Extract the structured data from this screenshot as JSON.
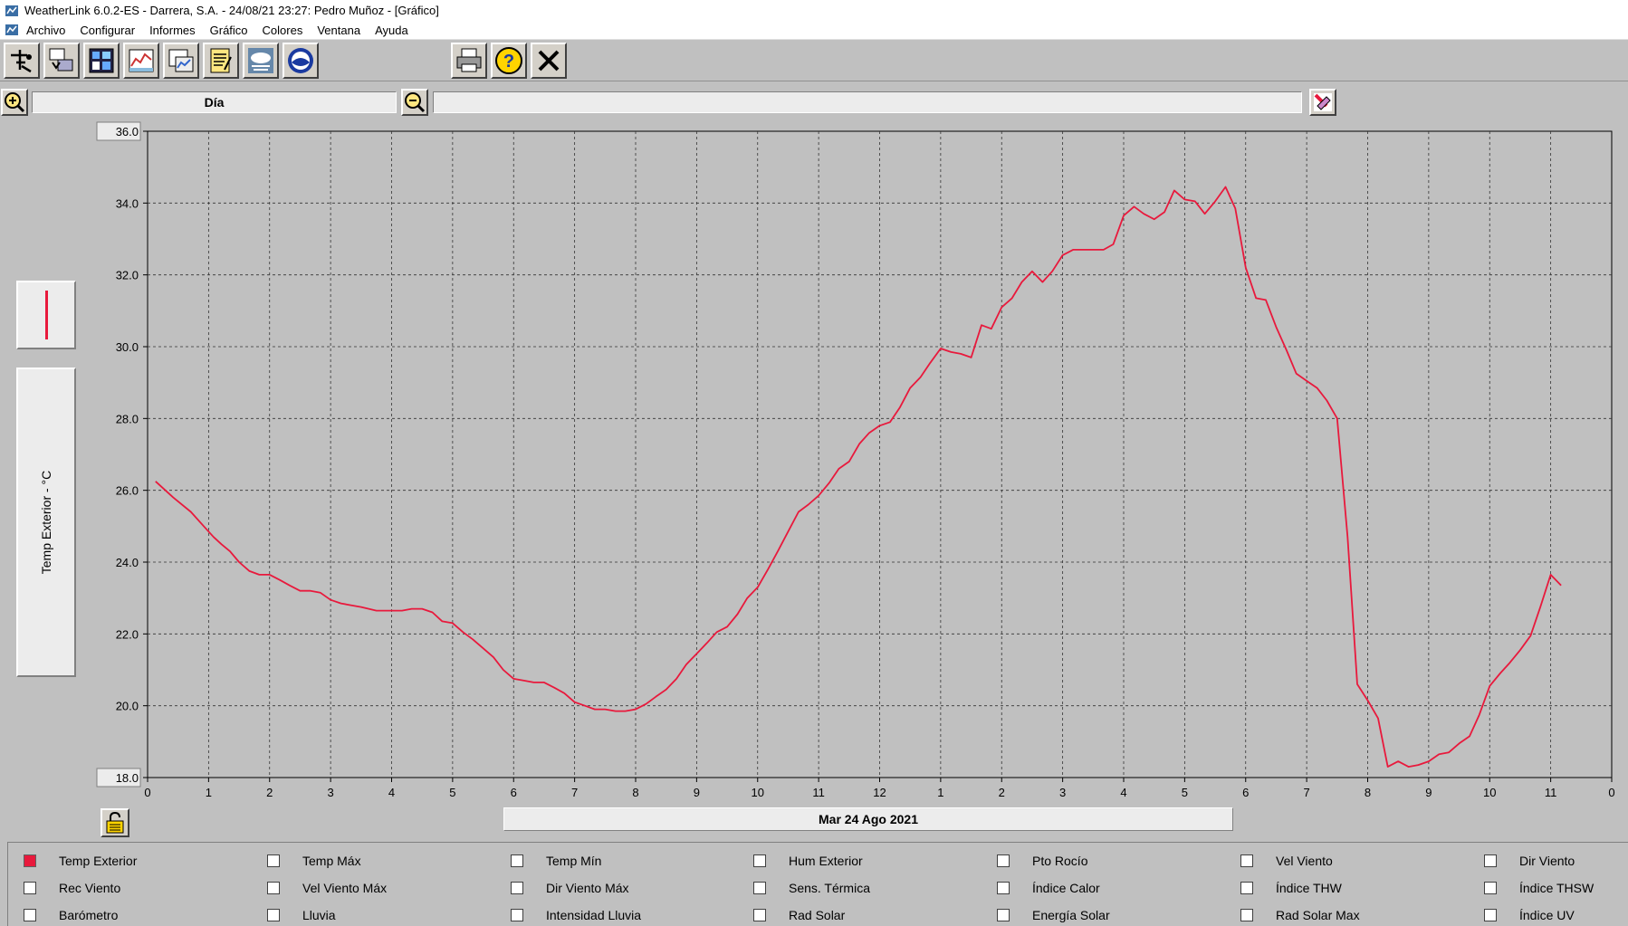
{
  "window": {
    "title": "WeatherLink 6.0.2-ES  -  Darrera, S.A.  -  24/08/21  23:27: Pedro Muñoz - [Gráfico]"
  },
  "menu": [
    "Archivo",
    "Configurar",
    "Informes",
    "Gráfico",
    "Colores",
    "Ventana",
    "Ayuda"
  ],
  "toolbar": {
    "buttons": [
      "teleport-icon",
      "download-icon",
      "bulletin-icon",
      "plot-icon",
      "browse-icon",
      "notes-icon",
      "weather-icon",
      "noaa-icon",
      "print-icon",
      "help-icon",
      "close-icon"
    ]
  },
  "zoom": {
    "period_label": "Día",
    "secondary_label": ""
  },
  "chart_side": {
    "axis_label": "Temp Exterior - °C",
    "series_color": "#e8193c"
  },
  "date_label": "Mar 24 Ago 2021",
  "chart_data": {
    "type": "line",
    "ylabel": "Temp Exterior - °C",
    "ylim": [
      18.0,
      36.0
    ],
    "yticks": [
      "36.0",
      "34.0",
      "32.0",
      "30.0",
      "28.0",
      "26.0",
      "24.0",
      "22.0",
      "20.0",
      "18.0"
    ],
    "xlim": [
      0,
      24
    ],
    "xticks": [
      "0",
      "1",
      "2",
      "3",
      "4",
      "5",
      "6",
      "7",
      "8",
      "9",
      "10",
      "11",
      "12",
      "1",
      "2",
      "3",
      "4",
      "5",
      "6",
      "7",
      "8",
      "9",
      "10",
      "11",
      "0"
    ],
    "grid": true,
    "series": [
      {
        "color": "#e8193c",
        "x": [
          0.13,
          0.42,
          0.71,
          0.92,
          1.08,
          1.21,
          1.35,
          1.5,
          1.67,
          1.83,
          2.0,
          2.17,
          2.33,
          2.5,
          2.67,
          2.83,
          3.0,
          3.17,
          3.33,
          3.5,
          3.75,
          3.92,
          4.17,
          4.33,
          4.5,
          4.67,
          4.83,
          5.0,
          5.17,
          5.33,
          5.5,
          5.67,
          5.83,
          6.0,
          6.17,
          6.33,
          6.5,
          6.67,
          6.83,
          7.0,
          7.17,
          7.33,
          7.5,
          7.67,
          7.83,
          8.0,
          8.17,
          8.33,
          8.5,
          8.67,
          8.83,
          9.0,
          9.17,
          9.33,
          9.5,
          9.67,
          9.83,
          10.0,
          10.17,
          10.33,
          10.5,
          10.67,
          10.83,
          11.0,
          11.17,
          11.33,
          11.5,
          11.67,
          11.83,
          12.0,
          12.17,
          12.33,
          12.5,
          12.67,
          12.83,
          13.0,
          13.17,
          13.33,
          13.5,
          13.67,
          13.83,
          14.0,
          14.17,
          14.33,
          14.5,
          14.67,
          14.83,
          15.0,
          15.17,
          15.33,
          15.5,
          15.67,
          15.83,
          16.0,
          16.17,
          16.33,
          16.5,
          16.67,
          16.83,
          17.0,
          17.17,
          17.33,
          17.5,
          17.67,
          17.83,
          18.0,
          18.17,
          18.33,
          18.5,
          18.67,
          18.83,
          19.0,
          19.17,
          19.33,
          19.5,
          19.67,
          19.83,
          20.0,
          20.17,
          20.33,
          20.5,
          20.67,
          20.83,
          21.0,
          21.17,
          21.33,
          21.5,
          21.67,
          21.83,
          22.0,
          22.17,
          22.33,
          22.5,
          22.67,
          22.83,
          23.0,
          23.17
        ],
        "y": [
          26.25,
          25.8,
          25.4,
          25.0,
          24.7,
          24.5,
          24.3,
          24.0,
          23.75,
          23.65,
          23.65,
          23.5,
          23.35,
          23.2,
          23.2,
          23.15,
          22.95,
          22.85,
          22.8,
          22.75,
          22.65,
          22.65,
          22.65,
          22.7,
          22.7,
          22.6,
          22.35,
          22.3,
          22.05,
          21.85,
          21.6,
          21.35,
          21.0,
          20.75,
          20.7,
          20.65,
          20.65,
          20.5,
          20.35,
          20.1,
          20.0,
          19.9,
          19.9,
          19.85,
          19.85,
          19.9,
          20.05,
          20.25,
          20.45,
          20.75,
          21.15,
          21.45,
          21.75,
          22.05,
          22.2,
          22.55,
          23.0,
          23.3,
          23.8,
          24.3,
          24.85,
          25.4,
          25.6,
          25.85,
          26.2,
          26.6,
          26.8,
          27.3,
          27.6,
          27.8,
          27.9,
          28.3,
          28.85,
          29.15,
          29.55,
          29.95,
          29.85,
          29.8,
          29.7,
          30.6,
          30.5,
          31.1,
          31.35,
          31.8,
          32.1,
          31.8,
          32.1,
          32.55,
          32.7,
          32.7,
          32.7,
          32.7,
          32.85,
          33.65,
          33.9,
          33.7,
          33.55,
          33.75,
          34.35,
          34.1,
          34.05,
          33.7,
          34.05,
          34.45,
          33.85,
          32.2,
          31.35,
          31.3,
          30.55,
          29.9,
          29.25,
          29.05,
          28.85,
          28.5,
          28.0,
          24.7,
          20.6,
          20.15,
          19.65,
          18.3,
          18.45,
          18.3,
          18.35,
          18.45,
          18.65,
          18.7,
          18.95,
          19.15,
          19.75,
          20.55,
          20.9,
          21.2,
          21.55,
          21.95,
          22.75,
          23.65,
          23.35
        ]
      }
    ]
  },
  "series_panel": {
    "items": [
      {
        "label": "Temp Exterior",
        "checked": true
      },
      {
        "label": "Temp Máx",
        "checked": false
      },
      {
        "label": "Temp Mín",
        "checked": false
      },
      {
        "label": "Hum Exterior",
        "checked": false
      },
      {
        "label": "Pto Rocío",
        "checked": false
      },
      {
        "label": "Vel Viento",
        "checked": false
      },
      {
        "label": "Dir Viento",
        "checked": false
      },
      {
        "label": "Rec Viento",
        "checked": false
      },
      {
        "label": "Vel Viento Máx",
        "checked": false
      },
      {
        "label": "Dir Viento Máx",
        "checked": false
      },
      {
        "label": "Sens. Térmica",
        "checked": false
      },
      {
        "label": "Índice Calor",
        "checked": false
      },
      {
        "label": "Índice THW",
        "checked": false
      },
      {
        "label": "Índice THSW",
        "checked": false
      },
      {
        "label": "Barómetro",
        "checked": false
      },
      {
        "label": "Lluvia",
        "checked": false
      },
      {
        "label": "Intensidad Lluvia",
        "checked": false
      },
      {
        "label": "Rad Solar",
        "checked": false
      },
      {
        "label": "Energía Solar",
        "checked": false
      },
      {
        "label": "Rad Solar Max",
        "checked": false
      },
      {
        "label": "Índice UV",
        "checked": false
      }
    ]
  }
}
